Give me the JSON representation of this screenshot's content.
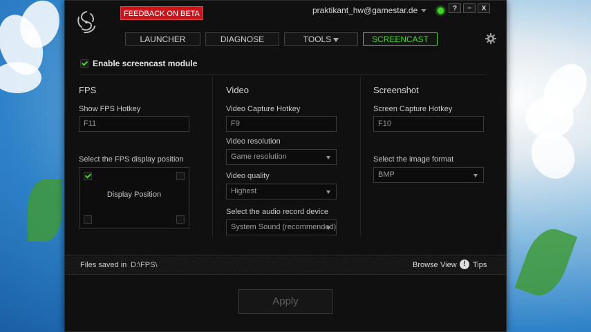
{
  "colors": {
    "accent": "#44d62c",
    "feedback": "#c8161d",
    "window_bg": "#101010"
  },
  "header": {
    "logo_icon": "razer-logo-icon",
    "feedback_label": "FEEDBACK ON BETA",
    "account_email": "praktikant_hw@gamestar.de",
    "window_controls": {
      "help": "?",
      "minimize": "−",
      "close": "X"
    }
  },
  "tabs": [
    {
      "label": "LAUNCHER",
      "active": false
    },
    {
      "label": "DIAGNOSE",
      "active": false
    },
    {
      "label": "TOOLS",
      "active": false
    },
    {
      "label": "SCREENCAST",
      "active": true
    }
  ],
  "settings_icon": "gear-icon",
  "enable": {
    "label": "Enable screencast module",
    "checked": true
  },
  "fps": {
    "title": "FPS",
    "hotkey_label": "Show FPS Hotkey",
    "hotkey_value": "F11",
    "position_label": "Select the FPS display position",
    "position_text": "Display Position",
    "selected_corner": "top-left"
  },
  "video": {
    "title": "Video",
    "hotkey_label": "Video Capture Hotkey",
    "hotkey_value": "F9",
    "resolution_label": "Video resolution",
    "resolution_value": "Game resolution",
    "quality_label": "Video quality",
    "quality_value": "Highest",
    "audio_label": "Select the audio record device",
    "audio_value": "System Sound (recommended)"
  },
  "screenshot": {
    "title": "Screenshot",
    "hotkey_label": "Screen Capture Hotkey",
    "hotkey_value": "F10",
    "format_label": "Select the image format",
    "format_value": "BMP"
  },
  "footer": {
    "files_label": "Files saved in",
    "path": "D:\\FPS\\",
    "browse": "Browse",
    "view": "View",
    "tips": "Tips"
  },
  "apply_label": "Apply"
}
